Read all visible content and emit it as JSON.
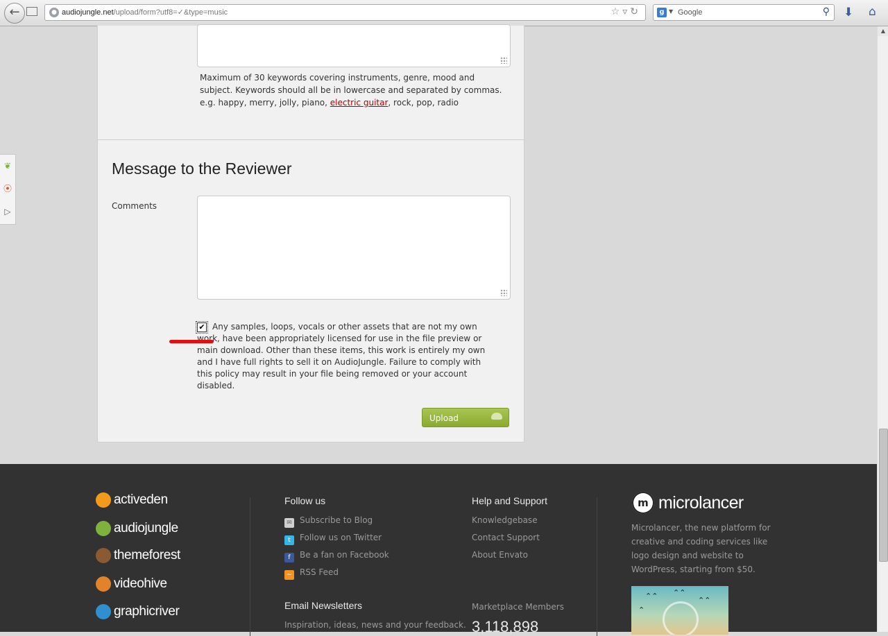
{
  "browser": {
    "url_domain": "audiojungle.net",
    "url_path": "/upload/form?utf8=✓&type=music",
    "search_engine_placeholder": "Google"
  },
  "form": {
    "keywords_hint_before": "Maximum of 30 keywords covering instruments, genre, mood and subject. Keywords should all be in lowercase and separated by commas. e.g. happy, merry, jolly, piano, ",
    "keywords_hint_link": "electric guitar",
    "keywords_hint_after": ", rock, pop, radio",
    "section_title": "Message to the Reviewer",
    "comments_label": "Comments",
    "comments_value": "",
    "consent_checked": true,
    "consent_text": "Any samples, loops, vocals or other assets that are not my own work, have been appropriately licensed for use in the file preview or main download. Other than these items, this work is entirely my own and I have full rights to sell it on AudioJungle. Failure to comply with this policy may result in your file being removed or your account disabled.",
    "upload_label": "Upload"
  },
  "footer": {
    "brands": [
      {
        "name": "activeden",
        "color": "#f39a1c"
      },
      {
        "name": "audiojungle",
        "color": "#7fb13f"
      },
      {
        "name": "themeforest",
        "color": "#8a5a33"
      },
      {
        "name": "videohive",
        "color": "#e2832a"
      },
      {
        "name": "graphicriver",
        "color": "#2f8fd1"
      }
    ],
    "follow": {
      "title": "Follow us",
      "links": [
        "Subscribe to Blog",
        "Follow us on Twitter",
        "Be a fan on Facebook",
        "RSS Feed"
      ]
    },
    "newsletters": {
      "title": "Email Newsletters",
      "text": "Inspiration, ideas, news and your feedback."
    },
    "support": {
      "title": "Help and Support",
      "links": [
        "Knowledgebase",
        "Contact Support",
        "About Envato"
      ]
    },
    "members": {
      "label": "Marketplace Members",
      "count": "3,118,898"
    },
    "microlancer": {
      "icon_text": "m",
      "name": "microlancer",
      "description": "Microlancer, the new platform for creative and coding services like logo design and website to WordPress, starting from $50."
    }
  },
  "colors": {
    "upload_button": "#9bb840",
    "footer_bg": "#323232",
    "link_red": "#b10000",
    "annotation_red": "#e01010"
  }
}
